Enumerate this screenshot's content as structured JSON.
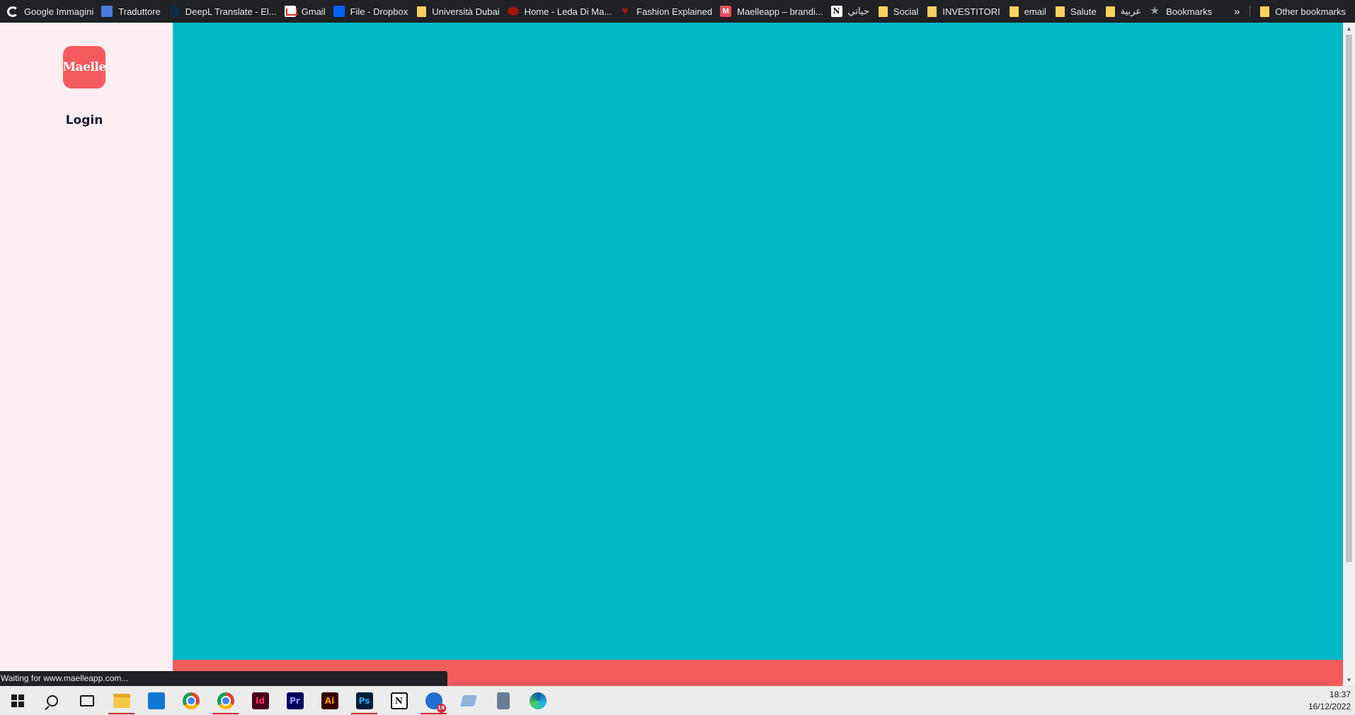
{
  "bookmarks": {
    "items": [
      {
        "label": "Google Immagini",
        "icon": "google-icon"
      },
      {
        "label": "Traduttore",
        "icon": "translate-icon"
      },
      {
        "label": "DeepL Translate - El...",
        "icon": "deepl-icon"
      },
      {
        "label": "Gmail",
        "icon": "gmail-icon"
      },
      {
        "label": "File - Dropbox",
        "icon": "dropbox-icon"
      },
      {
        "label": "Università Dubai",
        "icon": "folder-icon"
      },
      {
        "label": "Home - Leda Di Ma...",
        "icon": "leda-icon"
      },
      {
        "label": "Fashion Explained",
        "icon": "heart-icon"
      },
      {
        "label": "Maelleapp – brandi...",
        "icon": "maelle-icon"
      },
      {
        "label": "حياتي",
        "icon": "notion-icon"
      },
      {
        "label": "Social",
        "icon": "folder-icon"
      },
      {
        "label": "INVESTITORI",
        "icon": "folder-icon"
      },
      {
        "label": "email",
        "icon": "folder-icon"
      },
      {
        "label": "Salute",
        "icon": "folder-icon"
      },
      {
        "label": "عربية",
        "icon": "folder-icon"
      },
      {
        "label": "Bookmarks",
        "icon": "star-icon"
      }
    ],
    "more": "»",
    "other": "Other bookmarks"
  },
  "page": {
    "logo_text": "Maelle",
    "login_label": "Login",
    "colors": {
      "sidebar_bg": "#feeef1",
      "main_bg": "#00b8c6",
      "accent": "#f45b5b"
    }
  },
  "status": {
    "text": "Waiting for www.maelleapp.com..."
  },
  "taskbar": {
    "apps": [
      "windows-start-icon",
      "search-icon",
      "task-view-icon",
      "file-explorer-icon",
      "mail-icon",
      "chrome-icon",
      "chrome-profile-icon",
      "indesign-icon",
      "premiere-icon",
      "illustrator-icon",
      "photoshop-icon",
      "notion-icon",
      "thunderbird-icon",
      "eraser-icon",
      "calculator-icon",
      "edge-icon"
    ],
    "labels": {
      "indesign": "Id",
      "premiere": "Pr",
      "illustrator": "Ai",
      "photoshop": "Ps",
      "notion": "N",
      "thunderbird_badge": "18"
    },
    "time": "18:37",
    "date": "16/12/2022"
  }
}
